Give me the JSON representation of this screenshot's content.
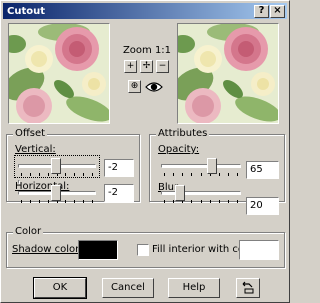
{
  "window": {
    "title": "Cutout",
    "help_glyph": "?",
    "close_glyph": "×"
  },
  "preview": {
    "zoom_label": "Zoom 1:1"
  },
  "toolbar": {
    "zoom_in_glyph": "+",
    "move_glyph": "✢",
    "zoom_out_glyph": "−",
    "proof_glyph": "⊕"
  },
  "offset": {
    "title": "Offset",
    "vertical_label": "Vertical:",
    "vertical_value": "-2",
    "vertical_level": 0.49,
    "horizontal_label": "Horizontal:",
    "horizontal_value": "-2",
    "horizontal_level": 0.49
  },
  "attributes": {
    "title": "Attributes",
    "opacity_label": "Opacity:",
    "opacity_value": "65",
    "opacity_level": 0.65,
    "blur_label": "Blur:",
    "blur_value": "20",
    "blur_level": 0.2
  },
  "color": {
    "title": "Color",
    "shadow_label": "Shadow color:",
    "shadow_color": "#000000",
    "fill_label": "Fill interior with color:",
    "fill_checked": false,
    "fill_color": "#ffffff"
  },
  "buttons": {
    "ok": "OK",
    "cancel": "Cancel",
    "help": "Help"
  },
  "icons": {
    "close": "close-icon",
    "help": "help-icon",
    "zoom_in": "zoom-in-icon",
    "move": "move-icon",
    "zoom_out": "zoom-out-icon",
    "proof": "proof-icon",
    "eye": "eye-icon",
    "reset": "reset-icon"
  },
  "colors": {
    "title_start": "#0a246a",
    "title_end": "#a6caf0",
    "face": "#d4d0c8"
  }
}
